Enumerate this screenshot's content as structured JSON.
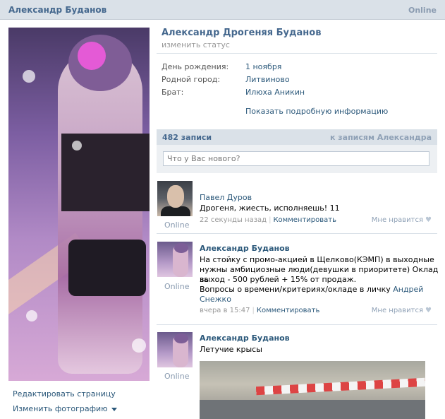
{
  "topbar": {
    "name": "Александр Буданов",
    "status": "Online"
  },
  "left": {
    "edit_page": "Редактировать страницу",
    "change_photo": "Изменить фотографию"
  },
  "profile": {
    "full_name": "Александр Дрогеняя Буданов",
    "status_placeholder": "изменить статус",
    "info": [
      {
        "label": "День рождения:",
        "value": "1 ноября"
      },
      {
        "label": "Родной город:",
        "value": "Литвиново"
      },
      {
        "label": "Брат:",
        "value": "Илюха Аникин"
      }
    ],
    "more_info": "Показать подробную информацию"
  },
  "wall": {
    "count": "482 записи",
    "to_posts": "к записям Александра",
    "input_placeholder": "Что у Вас нового?"
  },
  "posts": [
    {
      "author": "Павел Дуров",
      "online": "Online",
      "text": "Дрогеня, жиесть, исполняешь! 11",
      "time": "22 секунды назад",
      "comment": "Комментировать",
      "like": "Мне нравится"
    },
    {
      "author": "Александр Буданов",
      "online": "Online",
      "text_lines": [
        "На стойку с промо-акцией в Щелково(КЭМП) в выходные",
        "нужны амбициозные люди(девушки в приоритете) Оклад за",
        "выход - 500 рублей + 15% от продаж.",
        "Вопросы о времени/критериях/окладе в личку "
      ],
      "text_link": "Андрей",
      "text_link2": "Снежко",
      "time": "вчера в 15:47",
      "comment": "Комментировать",
      "like": "Мне нравится"
    },
    {
      "author": "Александр Буданов",
      "online": "Online",
      "text": "Летучие крысы"
    }
  ]
}
